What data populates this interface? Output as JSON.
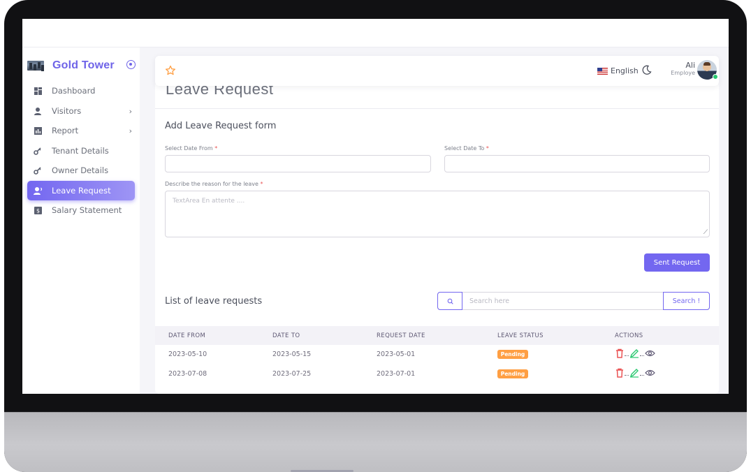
{
  "brand": {
    "name": "Gold Tower"
  },
  "sidebar": {
    "items": [
      {
        "label": "Dashboard",
        "icon": "dashboard-icon",
        "has_children": false,
        "active": false
      },
      {
        "label": "Visitors",
        "icon": "visitors-icon",
        "has_children": true,
        "active": false
      },
      {
        "label": "Report",
        "icon": "report-icon",
        "has_children": true,
        "active": false
      },
      {
        "label": "Tenant Details",
        "icon": "key-icon",
        "has_children": false,
        "active": false
      },
      {
        "label": "Owner Details",
        "icon": "key-icon",
        "has_children": false,
        "active": false
      },
      {
        "label": "Leave Request",
        "icon": "leave-request-icon",
        "has_children": false,
        "active": true
      },
      {
        "label": "Salary Statement",
        "icon": "salary-icon",
        "has_children": false,
        "active": false
      }
    ],
    "chevron": "›"
  },
  "navbar": {
    "language": "English",
    "user": {
      "name": "Ali",
      "role": "Employe"
    }
  },
  "page": {
    "title": "Leave Request",
    "form": {
      "title": "Add Leave Request form",
      "date_from_label": "Select Date From",
      "date_to_label": "Select Date To",
      "reason_label": "Describe the reason for the leave",
      "required_mark": "*",
      "reason_placeholder": "TextArea En attente ....",
      "submit_label": "Sent Request"
    },
    "list": {
      "title": "List of leave requests",
      "search_placeholder": "Search here",
      "search_button": "Search !",
      "columns": [
        "DATE FROM",
        "DATE TO",
        "REQUEST DATE",
        "LEAVE STATUS",
        "ACTIONS"
      ],
      "rows": [
        {
          "date_from": "2023-05-10",
          "date_to": "2023-05-15",
          "request_date": "2023-05-01",
          "status": "Pending"
        },
        {
          "date_from": "2023-07-08",
          "date_to": "2023-07-25",
          "request_date": "2023-07-01",
          "status": "Pending"
        }
      ]
    }
  },
  "colors": {
    "primary": "#7367f0",
    "pending": "#ff9f43",
    "delete": "#ea5455",
    "edit": "#28c76f"
  }
}
